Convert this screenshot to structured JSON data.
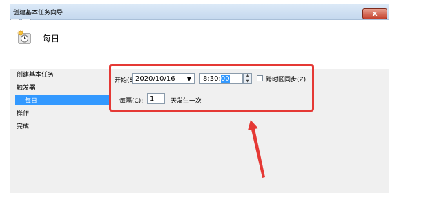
{
  "window": {
    "title": "创建基本任务向导",
    "close_label": "x"
  },
  "header": {
    "title": "每日",
    "icon": "task-scheduler-icon"
  },
  "sidebar": {
    "items": [
      {
        "label": "创建基本任务",
        "selected": false
      },
      {
        "label": "触发器",
        "selected": false
      },
      {
        "label": "每日",
        "selected": true
      },
      {
        "label": "操作",
        "selected": false
      },
      {
        "label": "完成",
        "selected": false
      }
    ]
  },
  "trigger": {
    "start_label": "开始(S):",
    "start_date": "2020/10/16",
    "time_prefix": "8:30:",
    "time_selected": "00",
    "sync_timezone_label": "跨时区同步(Z)",
    "sync_timezone_checked": false,
    "every_label": "每隔(C):",
    "every_value": "1",
    "every_suffix": "天发生一次"
  },
  "annotation": {
    "color": "#e53935"
  },
  "colors": {
    "selection": "#3399ff",
    "panel": "#f0f0f0",
    "highlight": "#e53935"
  }
}
